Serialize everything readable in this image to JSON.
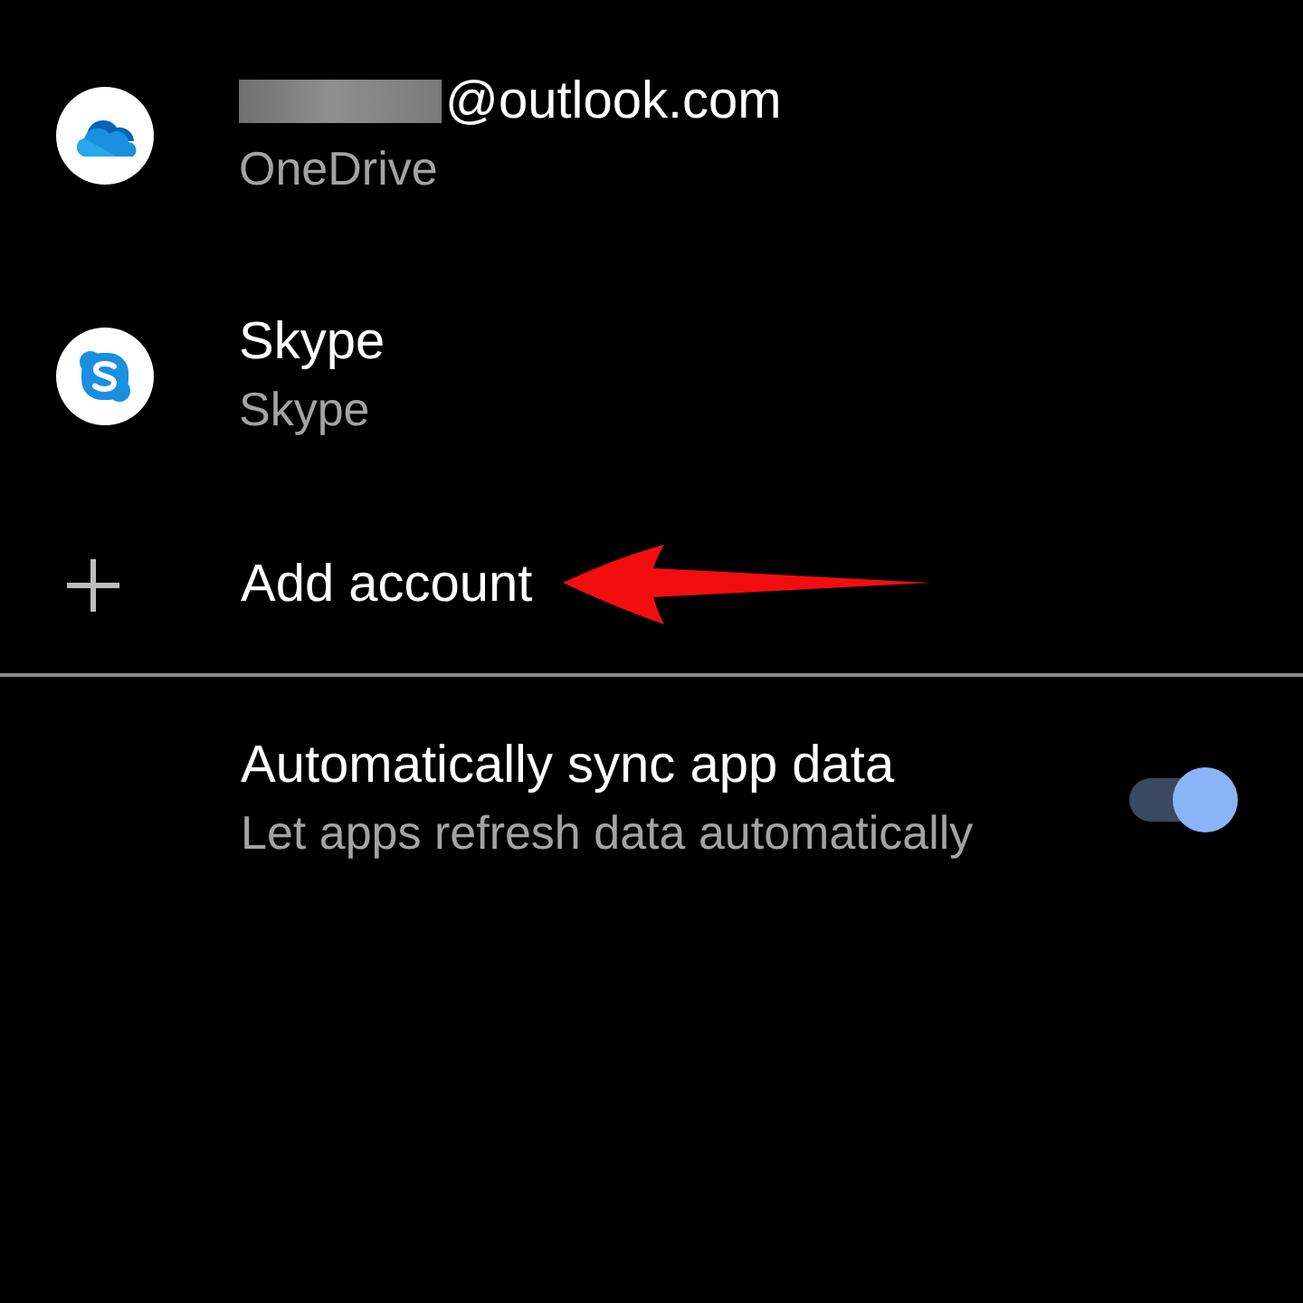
{
  "accounts": [
    {
      "kind": "onedrive",
      "title": "@outlook.com",
      "title_redacted": true,
      "subtitle": "OneDrive"
    },
    {
      "kind": "skype",
      "title": "Skype",
      "title_redacted": false,
      "subtitle": "Skype"
    }
  ],
  "add_account": {
    "label": "Add account",
    "annotations": [
      {
        "kind": "arrow"
      }
    ]
  },
  "sync": {
    "title": "Automatically sync app data",
    "subtitle": "Let apps refresh data automatically",
    "on": true
  }
}
